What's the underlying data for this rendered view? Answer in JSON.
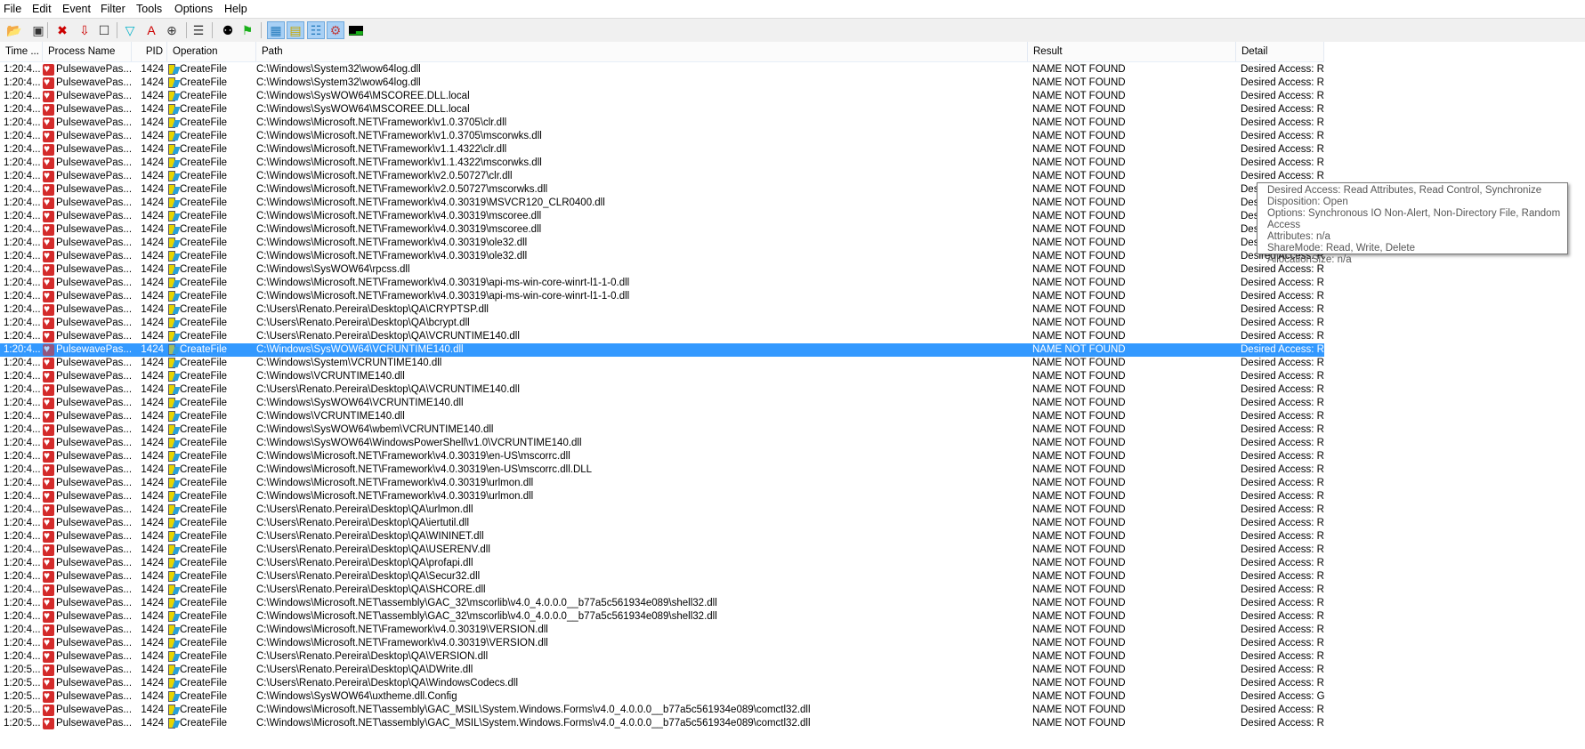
{
  "menu": [
    "File",
    "Edit",
    "Event",
    "Filter",
    "Tools",
    "Options",
    "Help"
  ],
  "toolbar": [
    {
      "icon": "open-icon",
      "active": false
    },
    {
      "icon": "save-icon",
      "active": false
    },
    {
      "icon": "capture-off-icon",
      "active": false
    },
    {
      "icon": "autoscroll-icon",
      "active": false
    },
    {
      "icon": "clear-icon",
      "active": false
    },
    {
      "icon": "filter-icon",
      "active": false
    },
    {
      "icon": "highlight-icon",
      "active": false
    },
    {
      "icon": "target-icon",
      "active": false
    },
    {
      "icon": "process-tree-icon",
      "active": false
    },
    {
      "icon": "find-icon",
      "active": false
    },
    {
      "icon": "jump-icon",
      "active": false
    },
    {
      "icon": "registry-activity-icon",
      "active": true
    },
    {
      "icon": "filesystem-activity-icon",
      "active": true
    },
    {
      "icon": "network-activity-icon",
      "active": true
    },
    {
      "icon": "process-activity-icon",
      "active": true
    },
    {
      "icon": "profiling-activity-icon",
      "active": false
    }
  ],
  "columns": {
    "time": "Time ...",
    "process": "Process Name",
    "pid": "PID",
    "operation": "Operation",
    "path": "Path",
    "result": "Result",
    "detail": "Detail"
  },
  "selected_row": 22,
  "colors": {
    "selection": "#3399ff",
    "process_icon": "#d42b2b"
  },
  "rows": [
    [
      "1:20:4...",
      "PulsewavePas....",
      "1424",
      "CreateFile",
      "C:\\Windows\\System32\\wow64log.dll",
      "NAME NOT FOUND",
      "Desired Access: R..."
    ],
    [
      "1:20:4...",
      "PulsewavePas....",
      "1424",
      "CreateFile",
      "C:\\Windows\\System32\\wow64log.dll",
      "NAME NOT FOUND",
      "Desired Access: R..."
    ],
    [
      "1:20:4...",
      "PulsewavePas....",
      "1424",
      "CreateFile",
      "C:\\Windows\\SysWOW64\\MSCOREE.DLL.local",
      "NAME NOT FOUND",
      "Desired Access: R..."
    ],
    [
      "1:20:4...",
      "PulsewavePas....",
      "1424",
      "CreateFile",
      "C:\\Windows\\SysWOW64\\MSCOREE.DLL.local",
      "NAME NOT FOUND",
      "Desired Access: R..."
    ],
    [
      "1:20:4...",
      "PulsewavePas....",
      "1424",
      "CreateFile",
      "C:\\Windows\\Microsoft.NET\\Framework\\v1.0.3705\\clr.dll",
      "NAME NOT FOUND",
      "Desired Access: R..."
    ],
    [
      "1:20:4...",
      "PulsewavePas....",
      "1424",
      "CreateFile",
      "C:\\Windows\\Microsoft.NET\\Framework\\v1.0.3705\\mscorwks.dll",
      "NAME NOT FOUND",
      "Desired Access: R..."
    ],
    [
      "1:20:4...",
      "PulsewavePas....",
      "1424",
      "CreateFile",
      "C:\\Windows\\Microsoft.NET\\Framework\\v1.1.4322\\clr.dll",
      "NAME NOT FOUND",
      "Desired Access: R..."
    ],
    [
      "1:20:4...",
      "PulsewavePas....",
      "1424",
      "CreateFile",
      "C:\\Windows\\Microsoft.NET\\Framework\\v1.1.4322\\mscorwks.dll",
      "NAME NOT FOUND",
      "Desired Access: R..."
    ],
    [
      "1:20:4...",
      "PulsewavePas....",
      "1424",
      "CreateFile",
      "C:\\Windows\\Microsoft.NET\\Framework\\v2.0.50727\\clr.dll",
      "NAME NOT FOUND",
      "Desired Access: R..."
    ],
    [
      "1:20:4...",
      "PulsewavePas....",
      "1424",
      "CreateFile",
      "C:\\Windows\\Microsoft.NET\\Framework\\v2.0.50727\\mscorwks.dll",
      "NAME NOT FOUND",
      "Desired Access: R..."
    ],
    [
      "1:20:4...",
      "PulsewavePas....",
      "1424",
      "CreateFile",
      "C:\\Windows\\Microsoft.NET\\Framework\\v4.0.30319\\MSVCR120_CLR0400.dll",
      "NAME NOT FOUND",
      "Desired Access: R..."
    ],
    [
      "1:20:4...",
      "PulsewavePas....",
      "1424",
      "CreateFile",
      "C:\\Windows\\Microsoft.NET\\Framework\\v4.0.30319\\mscoree.dll",
      "NAME NOT FOUND",
      "Desired Access: R..."
    ],
    [
      "1:20:4...",
      "PulsewavePas....",
      "1424",
      "CreateFile",
      "C:\\Windows\\Microsoft.NET\\Framework\\v4.0.30319\\mscoree.dll",
      "NAME NOT FOUND",
      "Desired Access: R..."
    ],
    [
      "1:20:4...",
      "PulsewavePas....",
      "1424",
      "CreateFile",
      "C:\\Windows\\Microsoft.NET\\Framework\\v4.0.30319\\ole32.dll",
      "NAME NOT FOUND",
      "Desired Access: R..."
    ],
    [
      "1:20:4...",
      "PulsewavePas....",
      "1424",
      "CreateFile",
      "C:\\Windows\\Microsoft.NET\\Framework\\v4.0.30319\\ole32.dll",
      "NAME NOT FOUND",
      "Desired Access: R..."
    ],
    [
      "1:20:4...",
      "PulsewavePas....",
      "1424",
      "CreateFile",
      "C:\\Windows\\SysWOW64\\rpcss.dll",
      "NAME NOT FOUND",
      "Desired Access: R..."
    ],
    [
      "1:20:4...",
      "PulsewavePas....",
      "1424",
      "CreateFile",
      "C:\\Windows\\Microsoft.NET\\Framework\\v4.0.30319\\api-ms-win-core-winrt-l1-1-0.dll",
      "NAME NOT FOUND",
      "Desired Access: R..."
    ],
    [
      "1:20:4...",
      "PulsewavePas....",
      "1424",
      "CreateFile",
      "C:\\Windows\\Microsoft.NET\\Framework\\v4.0.30319\\api-ms-win-core-winrt-l1-1-0.dll",
      "NAME NOT FOUND",
      "Desired Access: R..."
    ],
    [
      "1:20:4...",
      "PulsewavePas....",
      "1424",
      "CreateFile",
      "C:\\Users\\Renato.Pereira\\Desktop\\QA\\CRYPTSP.dll",
      "NAME NOT FOUND",
      "Desired Access: R..."
    ],
    [
      "1:20:4...",
      "PulsewavePas....",
      "1424",
      "CreateFile",
      "C:\\Users\\Renato.Pereira\\Desktop\\QA\\bcrypt.dll",
      "NAME NOT FOUND",
      "Desired Access: R..."
    ],
    [
      "1:20:4...",
      "PulsewavePas....",
      "1424",
      "CreateFile",
      "C:\\Users\\Renato.Pereira\\Desktop\\QA\\VCRUNTIME140.dll",
      "NAME NOT FOUND",
      "Desired Access: R..."
    ],
    [
      "1:20:4...",
      "PulsewavePas....",
      "1424",
      "CreateFile",
      "C:\\Windows\\SysWOW64\\VCRUNTIME140.dll",
      "NAME NOT FOUND",
      "Desired Access: R..."
    ],
    [
      "1:20:4...",
      "PulsewavePas....",
      "1424",
      "CreateFile",
      "C:\\Windows\\System\\VCRUNTIME140.dll",
      "NAME NOT FOUND",
      "Desired Access: R..."
    ],
    [
      "1:20:4...",
      "PulsewavePas....",
      "1424",
      "CreateFile",
      "C:\\Windows\\VCRUNTIME140.dll",
      "NAME NOT FOUND",
      "Desired Access: R..."
    ],
    [
      "1:20:4...",
      "PulsewavePas....",
      "1424",
      "CreateFile",
      "C:\\Users\\Renato.Pereira\\Desktop\\QA\\VCRUNTIME140.dll",
      "NAME NOT FOUND",
      "Desired Access: R..."
    ],
    [
      "1:20:4...",
      "PulsewavePas....",
      "1424",
      "CreateFile",
      "C:\\Windows\\SysWOW64\\VCRUNTIME140.dll",
      "NAME NOT FOUND",
      "Desired Access: R..."
    ],
    [
      "1:20:4...",
      "PulsewavePas....",
      "1424",
      "CreateFile",
      "C:\\Windows\\VCRUNTIME140.dll",
      "NAME NOT FOUND",
      "Desired Access: R..."
    ],
    [
      "1:20:4...",
      "PulsewavePas....",
      "1424",
      "CreateFile",
      "C:\\Windows\\SysWOW64\\wbem\\VCRUNTIME140.dll",
      "NAME NOT FOUND",
      "Desired Access: R..."
    ],
    [
      "1:20:4...",
      "PulsewavePas....",
      "1424",
      "CreateFile",
      "C:\\Windows\\SysWOW64\\WindowsPowerShell\\v1.0\\VCRUNTIME140.dll",
      "NAME NOT FOUND",
      "Desired Access: R..."
    ],
    [
      "1:20:4...",
      "PulsewavePas....",
      "1424",
      "CreateFile",
      "C:\\Windows\\Microsoft.NET\\Framework\\v4.0.30319\\en-US\\mscorrc.dll",
      "NAME NOT FOUND",
      "Desired Access: R..."
    ],
    [
      "1:20:4...",
      "PulsewavePas....",
      "1424",
      "CreateFile",
      "C:\\Windows\\Microsoft.NET\\Framework\\v4.0.30319\\en-US\\mscorrc.dll.DLL",
      "NAME NOT FOUND",
      "Desired Access: R..."
    ],
    [
      "1:20:4...",
      "PulsewavePas....",
      "1424",
      "CreateFile",
      "C:\\Windows\\Microsoft.NET\\Framework\\v4.0.30319\\urlmon.dll",
      "NAME NOT FOUND",
      "Desired Access: R..."
    ],
    [
      "1:20:4...",
      "PulsewavePas....",
      "1424",
      "CreateFile",
      "C:\\Windows\\Microsoft.NET\\Framework\\v4.0.30319\\urlmon.dll",
      "NAME NOT FOUND",
      "Desired Access: R..."
    ],
    [
      "1:20:4...",
      "PulsewavePas....",
      "1424",
      "CreateFile",
      "C:\\Users\\Renato.Pereira\\Desktop\\QA\\urlmon.dll",
      "NAME NOT FOUND",
      "Desired Access: R..."
    ],
    [
      "1:20:4...",
      "PulsewavePas....",
      "1424",
      "CreateFile",
      "C:\\Users\\Renato.Pereira\\Desktop\\QA\\iertutil.dll",
      "NAME NOT FOUND",
      "Desired Access: R..."
    ],
    [
      "1:20:4...",
      "PulsewavePas....",
      "1424",
      "CreateFile",
      "C:\\Users\\Renato.Pereira\\Desktop\\QA\\WININET.dll",
      "NAME NOT FOUND",
      "Desired Access: R..."
    ],
    [
      "1:20:4...",
      "PulsewavePas....",
      "1424",
      "CreateFile",
      "C:\\Users\\Renato.Pereira\\Desktop\\QA\\USERENV.dll",
      "NAME NOT FOUND",
      "Desired Access: R..."
    ],
    [
      "1:20:4...",
      "PulsewavePas....",
      "1424",
      "CreateFile",
      "C:\\Users\\Renato.Pereira\\Desktop\\QA\\profapi.dll",
      "NAME NOT FOUND",
      "Desired Access: R..."
    ],
    [
      "1:20:4...",
      "PulsewavePas....",
      "1424",
      "CreateFile",
      "C:\\Users\\Renato.Pereira\\Desktop\\QA\\Secur32.dll",
      "NAME NOT FOUND",
      "Desired Access: R..."
    ],
    [
      "1:20:4...",
      "PulsewavePas....",
      "1424",
      "CreateFile",
      "C:\\Users\\Renato.Pereira\\Desktop\\QA\\SHCORE.dll",
      "NAME NOT FOUND",
      "Desired Access: R..."
    ],
    [
      "1:20:4...",
      "PulsewavePas....",
      "1424",
      "CreateFile",
      "C:\\Windows\\Microsoft.NET\\assembly\\GAC_32\\mscorlib\\v4.0_4.0.0.0__b77a5c561934e089\\shell32.dll",
      "NAME NOT FOUND",
      "Desired Access: R..."
    ],
    [
      "1:20:4...",
      "PulsewavePas....",
      "1424",
      "CreateFile",
      "C:\\Windows\\Microsoft.NET\\assembly\\GAC_32\\mscorlib\\v4.0_4.0.0.0__b77a5c561934e089\\shell32.dll",
      "NAME NOT FOUND",
      "Desired Access: R..."
    ],
    [
      "1:20:4...",
      "PulsewavePas....",
      "1424",
      "CreateFile",
      "C:\\Windows\\Microsoft.NET\\Framework\\v4.0.30319\\VERSION.dll",
      "NAME NOT FOUND",
      "Desired Access: R..."
    ],
    [
      "1:20:4...",
      "PulsewavePas....",
      "1424",
      "CreateFile",
      "C:\\Windows\\Microsoft.NET\\Framework\\v4.0.30319\\VERSION.dll",
      "NAME NOT FOUND",
      "Desired Access: R..."
    ],
    [
      "1:20:4...",
      "PulsewavePas....",
      "1424",
      "CreateFile",
      "C:\\Users\\Renato.Pereira\\Desktop\\QA\\VERSION.dll",
      "NAME NOT FOUND",
      "Desired Access: R..."
    ],
    [
      "1:20:5...",
      "PulsewavePas....",
      "1424",
      "CreateFile",
      "C:\\Users\\Renato.Pereira\\Desktop\\QA\\DWrite.dll",
      "NAME NOT FOUND",
      "Desired Access: R..."
    ],
    [
      "1:20:5...",
      "PulsewavePas....",
      "1424",
      "CreateFile",
      "C:\\Users\\Renato.Pereira\\Desktop\\QA\\WindowsCodecs.dll",
      "NAME NOT FOUND",
      "Desired Access: R..."
    ],
    [
      "1:20:5...",
      "PulsewavePas....",
      "1424",
      "CreateFile",
      "C:\\Windows\\SysWOW64\\uxtheme.dll.Config",
      "NAME NOT FOUND",
      "Desired Access: G..."
    ],
    [
      "1:20:5...",
      "PulsewavePas....",
      "1424",
      "CreateFile",
      "C:\\Windows\\Microsoft.NET\\assembly\\GAC_MSIL\\System.Windows.Forms\\v4.0_4.0.0.0__b77a5c561934e089\\comctl32.dll",
      "NAME NOT FOUND",
      "Desired Access: R..."
    ],
    [
      "1:20:5...",
      "PulsewavePas....",
      "1424",
      "CreateFile",
      "C:\\Windows\\Microsoft.NET\\assembly\\GAC_MSIL\\System.Windows.Forms\\v4.0_4.0.0.0__b77a5c561934e089\\comctl32.dll",
      "NAME NOT FOUND",
      "Desired Access: R..."
    ]
  ],
  "tooltip": [
    "Desired Access: Read Attributes, Read Control, Synchronize",
    "Disposition: Open",
    "Options: Synchronous IO Non-Alert, Non-Directory File, Random Access",
    "Attributes: n/a",
    "ShareMode: Read, Write, Delete",
    "AllocationSize: n/a"
  ]
}
